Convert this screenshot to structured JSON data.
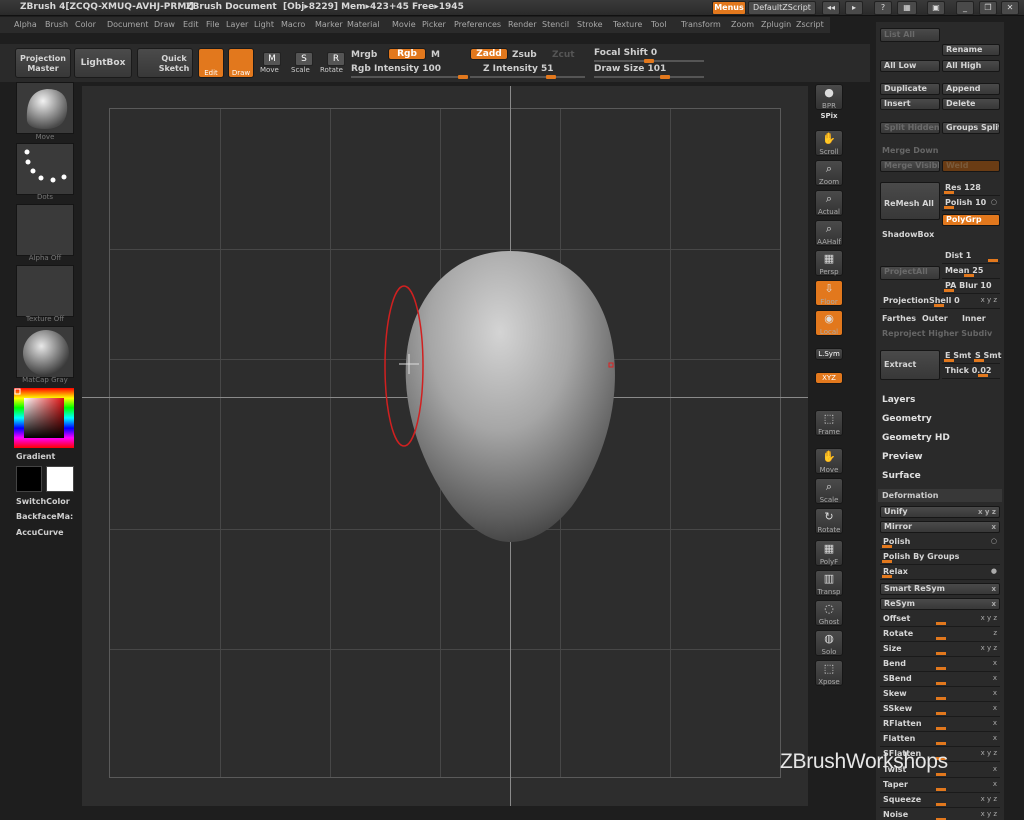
{
  "titlebar": {
    "app": "ZBrush 4[ZCQQ-XMUQ-AVHJ-PRMI]",
    "doc": "ZBrush Document",
    "stats": "[Obj▸8229] Mem▸423+45 Free▸1945",
    "menus_btn": "Menus",
    "zscript_btn": "DefaultZScript"
  },
  "menubar": [
    "Alpha",
    "Brush",
    "Color",
    "Document",
    "Draw",
    "Edit",
    "File",
    "Layer",
    "Light",
    "Macro",
    "Marker",
    "Material",
    "Movie",
    "Picker",
    "Preferences",
    "Render",
    "Stencil",
    "Stroke",
    "Texture",
    "Tool",
    "Transform",
    "Zoom",
    "Zplugin",
    "Zscript"
  ],
  "toolbar": {
    "projection_master": "Projection Master",
    "lightbox": "LightBox",
    "quick_sketch": "Quick Sketch",
    "edit": "Edit",
    "draw": "Draw",
    "move": "Move",
    "scale": "Scale",
    "rotate": "Rotate",
    "mrgb": "Mrgb",
    "rgb": "Rgb",
    "m": "M",
    "rgb_intensity": "Rgb Intensity 100",
    "zadd": "Zadd",
    "zsub": "Zsub",
    "zcut": "Zcut",
    "z_intensity": "Z Intensity 51",
    "focal_shift": "Focal Shift 0",
    "draw_size": "Draw Size 101"
  },
  "leftshelf": {
    "brush_label": "Move",
    "stroke_label": "Dots",
    "alpha_label": "Alpha Off",
    "texture_label": "Texture Off",
    "material_label": "MatCap Gray",
    "gradient": "Gradient",
    "switchcolor": "SwitchColor",
    "backfacemask": "BackfaceMa:",
    "accucurve": "AccuCurve"
  },
  "righttools": [
    "BPR",
    "SPix",
    "Scroll",
    "Zoom",
    "Actual",
    "AAHalf",
    "Persp",
    "Floor",
    "Local",
    "L.Sym",
    "XYZ",
    "Frame",
    "Move",
    "Scale",
    "Rotate",
    "PolyF",
    "Transp",
    "Ghost",
    "Solo",
    "Xpose"
  ],
  "panel": {
    "list_all": "List All",
    "rename": "Rename",
    "all_low": "All Low",
    "all_high": "All High",
    "duplicate": "Duplicate",
    "append": "Append",
    "insert": "Insert",
    "delete": "Delete",
    "split_hidden": "Split Hidden",
    "groups_split": "Groups Split",
    "merge_down": "Merge Down",
    "merge_visible": "Merge Visible",
    "weld": "Weld",
    "remesh_all": "ReMesh All",
    "res": "Res 128",
    "polish": "Polish 10",
    "polygrp": "PolyGrp",
    "shadowbox": "ShadowBox",
    "dist": "Dist 1",
    "projectall": "ProjectAll",
    "mean": "Mean 25",
    "pa_blur": "PA Blur 10",
    "projectionshell": "ProjectionShell 0",
    "farthest": "Farthes",
    "outer": "Outer",
    "inner": "Inner",
    "reproject": "Reproject Higher Subdiv",
    "extract": "Extract",
    "e_smt": "E Smt",
    "s_smt": "S Smt",
    "thick": "Thick 0.02",
    "layers": "Layers",
    "geometry": "Geometry",
    "geometry_hd": "Geometry HD",
    "preview": "Preview",
    "surface": "Surface",
    "deformation": "Deformation",
    "deform_items": [
      "Unify",
      "Mirror",
      "Polish",
      "Polish By Groups",
      "Relax",
      "Smart ReSym",
      "ReSym",
      "Offset",
      "Rotate",
      "Size",
      "Bend",
      "SBend",
      "Skew",
      "SSkew",
      "RFlatten",
      "Flatten",
      "SFlatten",
      "Twist",
      "Taper",
      "Squeeze",
      "Noise"
    ]
  },
  "watermark": "ZBrushWorkshops"
}
